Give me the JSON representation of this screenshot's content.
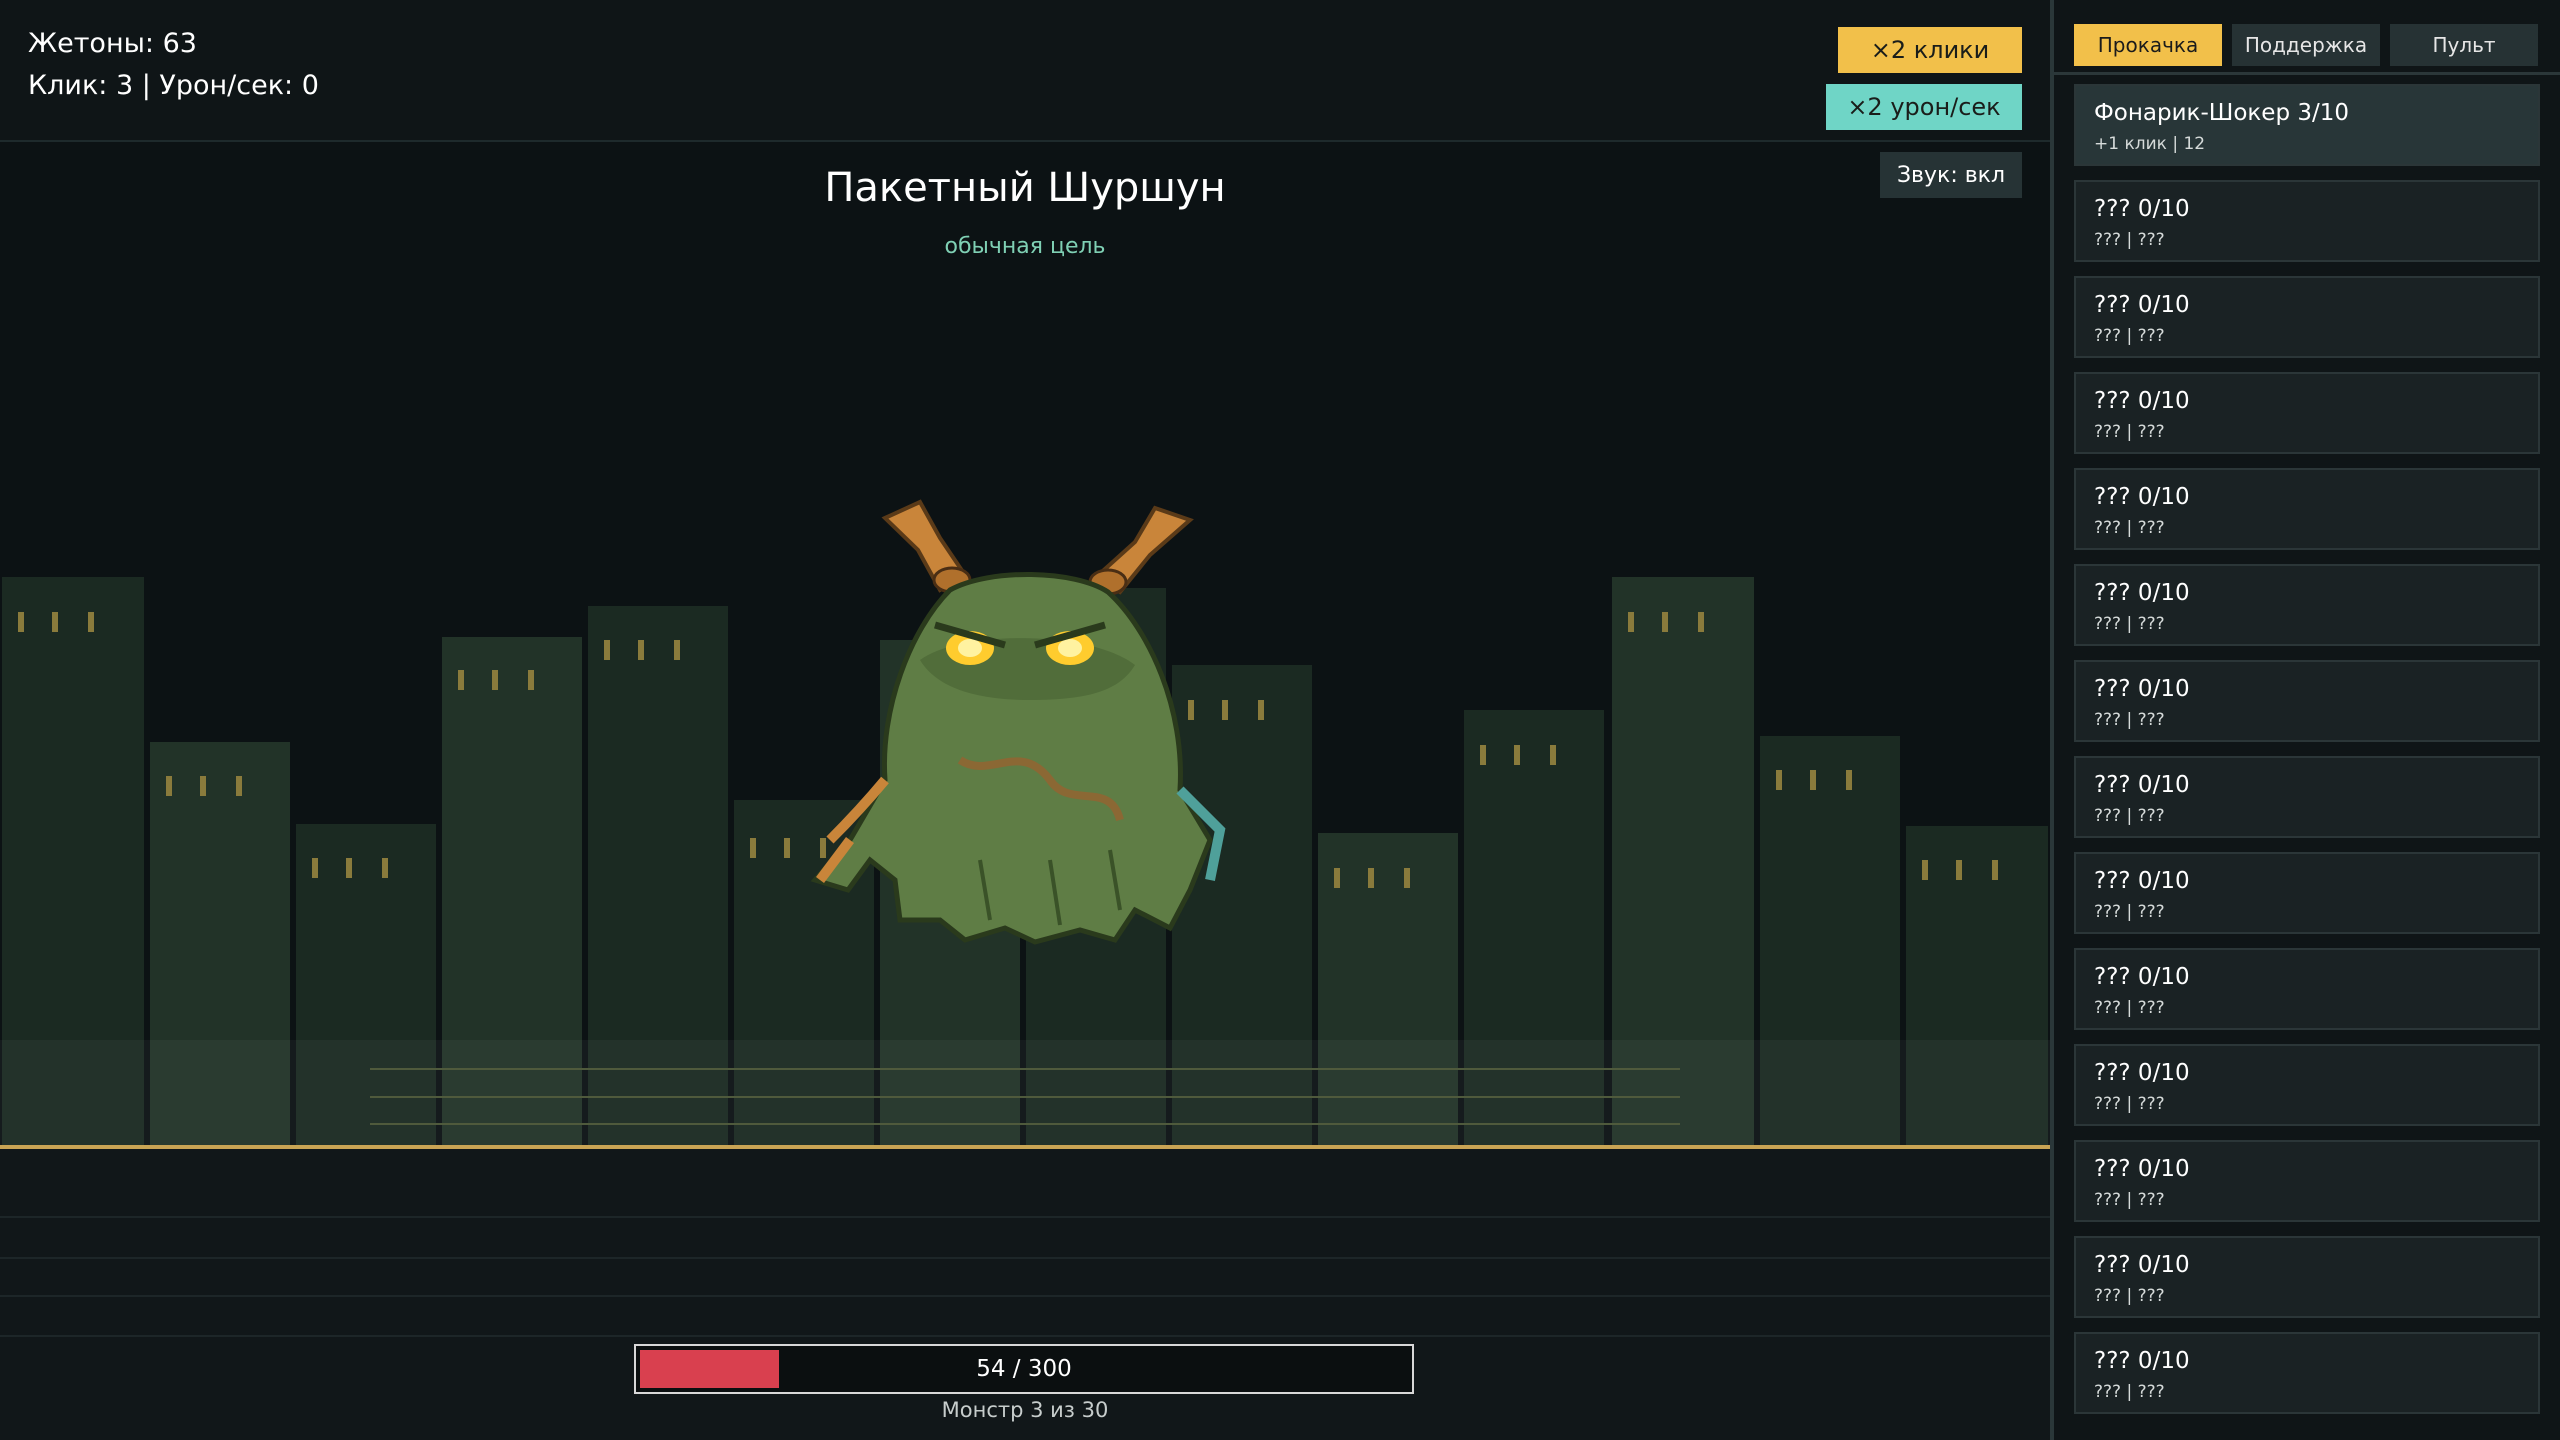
{
  "stats": {
    "tokens": "Жетоны: 63",
    "click_line": "Клик: 3 | Урон/сек: 0"
  },
  "boosts": {
    "x2_click": "×2 клики",
    "x2_dps": "×2 урон/сек"
  },
  "sound": "Звук: вкл",
  "monster": {
    "name": "Пакетный Шуршун",
    "tag": "обычная цель",
    "hp_text": "54 / 300",
    "hp_fraction": 0.18,
    "progress": "Монстр 3 из 30"
  },
  "tabs": [
    "Прокачка",
    "Поддержка",
    "Пульт"
  ],
  "upgrades": [
    {
      "title": "Фонарик-Шокер 3/10",
      "sub": "+1 клик | 12"
    },
    {
      "title": "??? 0/10",
      "sub": "??? | ???"
    },
    {
      "title": "??? 0/10",
      "sub": "??? | ???"
    },
    {
      "title": "??? 0/10",
      "sub": "??? | ???"
    },
    {
      "title": "??? 0/10",
      "sub": "??? | ???"
    },
    {
      "title": "??? 0/10",
      "sub": "??? | ???"
    },
    {
      "title": "??? 0/10",
      "sub": "??? | ???"
    },
    {
      "title": "??? 0/10",
      "sub": "??? | ???"
    },
    {
      "title": "??? 0/10",
      "sub": "??? | ???"
    },
    {
      "title": "??? 0/10",
      "sub": "??? | ???"
    },
    {
      "title": "??? 0/10",
      "sub": "??? | ???"
    },
    {
      "title": "??? 0/10",
      "sub": "??? | ???"
    },
    {
      "title": "??? 0/10",
      "sub": "??? | ???"
    },
    {
      "title": "??? 0/10",
      "sub": "??? | ???"
    }
  ],
  "colors": {
    "gold": "#f2c04a",
    "teal": "#6fd5c6",
    "hp": "#d9404f",
    "tag": "#7fd0b4"
  }
}
